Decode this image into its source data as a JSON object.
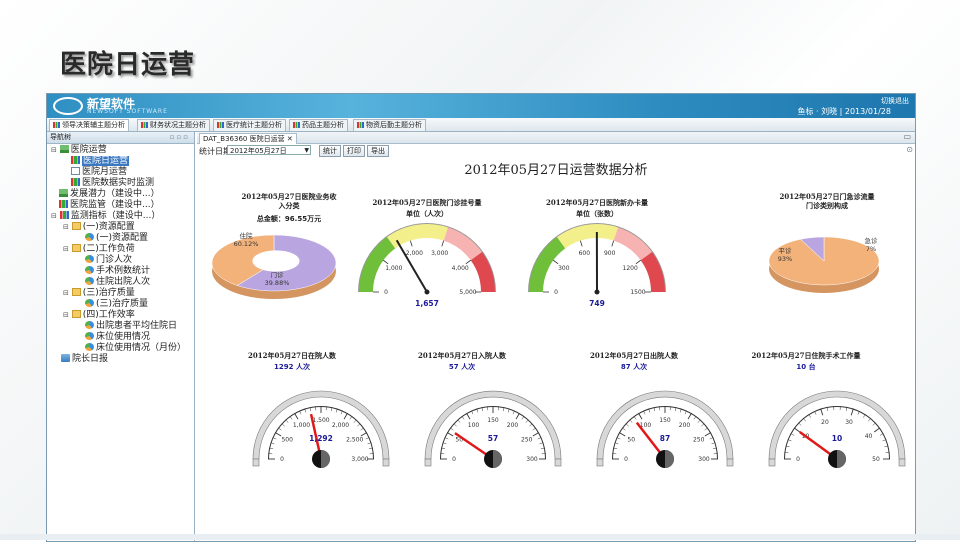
{
  "slide": {
    "title": "医院日运营"
  },
  "app": {
    "logo_name": "新望软件",
    "logo_sub": "NEWSOFT SOFTWARE",
    "user_info": "鱼标 · 刘晓 | 2013/01/28",
    "exit_label": "切换退出"
  },
  "top_tabs": [
    {
      "label": "领导决策辅主题分析"
    },
    {
      "label": "财务状况主题分析"
    },
    {
      "label": "医疗统计主题分析"
    },
    {
      "label": "药品主题分析"
    },
    {
      "label": "物资后勤主题分析"
    }
  ],
  "nav": {
    "header": "导航树",
    "items": [
      {
        "label": "医院运营"
      },
      {
        "label": "医院日运营"
      },
      {
        "label": "医院月运营"
      },
      {
        "label": "医院数据实时监测"
      },
      {
        "label": "发展潜力（建设中...）"
      },
      {
        "label": "医院监管（建设中...）"
      },
      {
        "label": "监测指标（建设中...）"
      },
      {
        "label": "(一)资源配置"
      },
      {
        "label": "(一)资源配置"
      },
      {
        "label": "(二)工作负荷"
      },
      {
        "label": "门诊人次"
      },
      {
        "label": "手术例数统计"
      },
      {
        "label": "住院出院人次"
      },
      {
        "label": "(三)治疗质量"
      },
      {
        "label": "(三)治疗质量"
      },
      {
        "label": "(四)工作效率"
      },
      {
        "label": "出院患者平均住院日"
      },
      {
        "label": "床位使用情况"
      },
      {
        "label": "床位使用情况（月份）"
      },
      {
        "label": "院长日报"
      }
    ]
  },
  "content": {
    "tab_label": "DAT_B36360 医院日运营",
    "toolbar": {
      "date_label": "统计日期",
      "date_value": "2012年05月27日",
      "stat_button": "统计",
      "print_button": "打印",
      "export_button": "导出"
    },
    "main_title": "2012年05月27日运营数据分析"
  },
  "colors": {
    "banner": "#2f8fc2",
    "gauge_green": "#6fbf3a",
    "gauge_yellow": "#f3ef8a",
    "gauge_red": "#e0484f",
    "pie_orange": "#f2b27a",
    "pie_purple": "#b9a6e0"
  },
  "chart_data": [
    {
      "type": "pie",
      "title": "2012年05月27日医院业务收入分类",
      "subtitle": "总金额：96.55万元",
      "slices": [
        {
          "label": "住院",
          "percent": 60.12,
          "text": "住院\n60.12%"
        },
        {
          "label": "门诊",
          "percent": 39.88,
          "text": "门诊\n39.88%"
        }
      ]
    },
    {
      "type": "gauge",
      "title": "2012年05月27日医院门诊挂号量",
      "unit": "单位（人次）",
      "min": 0,
      "max": 5000,
      "value": 1657,
      "ticks": [
        0,
        1000,
        2000,
        3000,
        4000,
        5000
      ],
      "tick_labels": [
        "0",
        "1,000",
        "2,000",
        "3,000",
        "4,000",
        "5,000"
      ],
      "value_label": "1,657"
    },
    {
      "type": "gauge",
      "title": "2012年05月27日医院新办卡量",
      "unit": "单位（张数）",
      "min": 0,
      "max": 1500,
      "value": 749,
      "ticks": [
        0,
        300,
        600,
        900,
        1200,
        1500
      ],
      "tick_labels": [
        "0",
        "300",
        "600",
        "900",
        "1200",
        "1500"
      ],
      "value_label": "749"
    },
    {
      "type": "pie",
      "title": "2012年05月27日门急诊流量门诊类别构成",
      "slices": [
        {
          "label": "平诊",
          "percent": 93,
          "text": "平诊\n93%"
        },
        {
          "label": "急诊",
          "percent": 7,
          "text": "急诊\n7%"
        }
      ]
    },
    {
      "type": "gauge",
      "title": "2012年05月27日在院人数",
      "subtitle": "1292  人次",
      "min": 0,
      "max": 3000,
      "value": 1292,
      "ticks": [
        0,
        500,
        1000,
        1500,
        2000,
        2500,
        3000
      ],
      "tick_labels": [
        "0",
        "500",
        "1,000",
        "1,500",
        "2,000",
        "2,500",
        "3,000"
      ],
      "value_label": "1,292"
    },
    {
      "type": "gauge",
      "title": "2012年05月27日入院人数",
      "subtitle": "57  人次",
      "min": 0,
      "max": 300,
      "value": 57,
      "ticks": [
        0,
        50,
        100,
        150,
        200,
        250,
        300
      ],
      "tick_labels": [
        "0",
        "50",
        "100",
        "150",
        "200",
        "250",
        "300"
      ],
      "value_label": "57"
    },
    {
      "type": "gauge",
      "title": "2012年05月27日出院人数",
      "subtitle": "87  人次",
      "min": 0,
      "max": 300,
      "value": 87,
      "ticks": [
        0,
        50,
        100,
        150,
        200,
        250,
        300
      ],
      "tick_labels": [
        "0",
        "50",
        "100",
        "150",
        "200",
        "250",
        "300"
      ],
      "value_label": "87"
    },
    {
      "type": "gauge",
      "title": "2012年05月27日住院手术工作量",
      "subtitle": "10  台",
      "min": 0,
      "max": 50,
      "value": 10,
      "ticks": [
        0,
        10,
        20,
        30,
        40,
        50
      ],
      "tick_labels": [
        "0",
        "10",
        "20",
        "30",
        "40",
        "50"
      ],
      "value_label": "10"
    }
  ]
}
